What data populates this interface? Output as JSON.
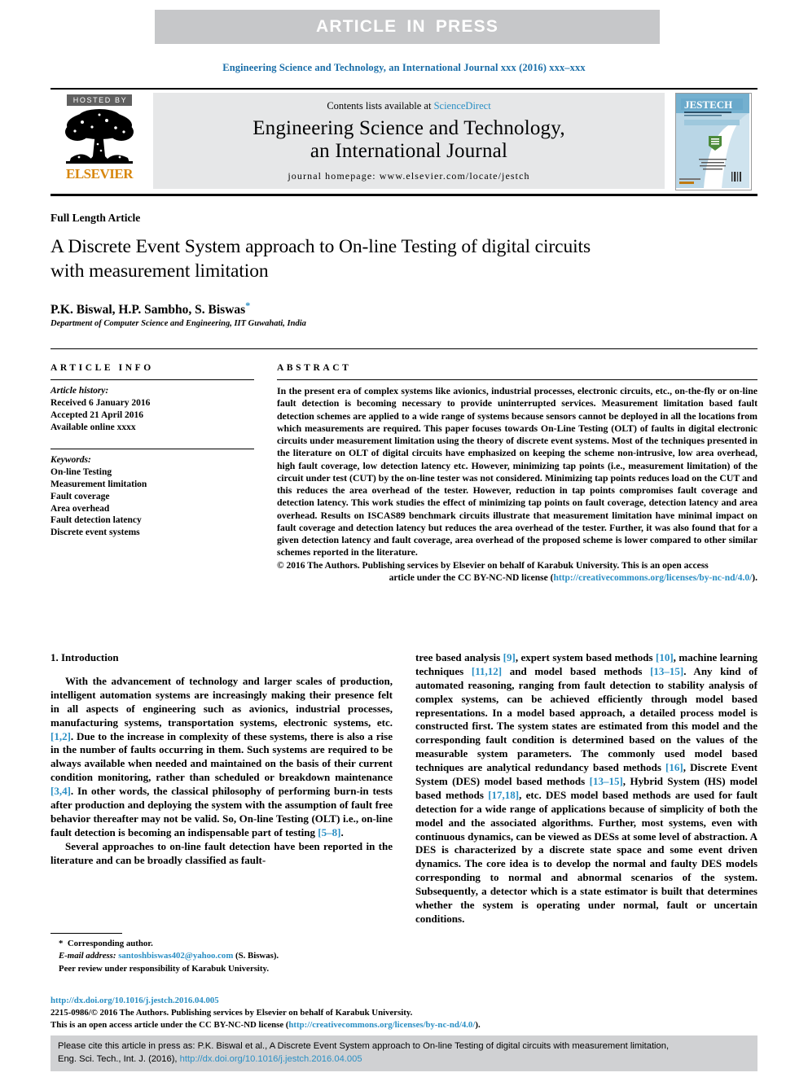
{
  "banner": {
    "text": "ARTICLE  IN  PRESS",
    "bg_color": "#c6c7c9",
    "text_color": "#ffffff"
  },
  "running_head": {
    "text": "Engineering Science and Technology, an International Journal xxx (2016) xxx–xxx",
    "color": "#1a6ea8"
  },
  "masthead": {
    "hosted_by_label": "HOSTED BY",
    "publisher_name": "ELSEVIER",
    "publisher_color": "#d8870d",
    "contents_prefix": "Contents lists available at ",
    "contents_link": "ScienceDirect",
    "journal_title_line1": "Engineering Science and Technology,",
    "journal_title_line2": "an International Journal",
    "homepage_text": "journal homepage: www.elsevier.com/locate/jestch",
    "cover_title": "JESTECH",
    "cover_subtitle": "ENGINEERING SCIENCE AND TECHNOLOGY",
    "cover_subtitle2": "an international journal",
    "link_color": "#2a8fc4"
  },
  "article": {
    "type": "Full Length Article",
    "title": "A Discrete Event System approach to On-line Testing of digital circuits with measurement limitation",
    "authors": "P.K. Biswal, H.P. Sambho, S. Biswas",
    "corresponding_marker": "*",
    "affiliation": "Department of Computer Science and Engineering, IIT Guwahati, India"
  },
  "article_info": {
    "heading": "ARTICLE INFO",
    "history_label": "Article history:",
    "history": [
      "Received 6 January 2016",
      "Accepted 21 April 2016",
      "Available online xxxx"
    ],
    "keywords_label": "Keywords:",
    "keywords": [
      "On-line Testing",
      "Measurement limitation",
      "Fault coverage",
      "Area overhead",
      "Fault detection latency",
      "Discrete event systems"
    ]
  },
  "abstract": {
    "heading": "ABSTRACT",
    "body": "In the present era of complex systems like avionics, industrial processes, electronic circuits, etc., on-the-fly or on-line fault detection is becoming necessary to provide uninterrupted services. Measurement limitation based fault detection schemes are applied to a wide range of systems because sensors cannot be deployed in all the locations from which measurements are required. This paper focuses towards On-Line Testing (OLT) of faults in digital electronic circuits under measurement limitation using the theory of discrete event systems. Most of the techniques presented in the literature on OLT of digital circuits have emphasized on keeping the scheme non-intrusive, low area overhead, high fault coverage, low detection latency etc. However, minimizing tap points (i.e., measurement limitation) of the circuit under test (CUT) by the on-line tester was not considered. Minimizing tap points reduces load on the CUT and this reduces the area overhead of the tester. However, reduction in tap points compromises fault coverage and detection latency. This work studies the effect of minimizing tap points on fault coverage, detection latency and area overhead. Results on ISCAS89 benchmark circuits illustrate that measurement limitation have minimal impact on fault coverage and detection latency but reduces the area overhead of the tester. Further, it was also found that for a given detection latency and fault coverage, area overhead of the proposed scheme is lower compared to other similar schemes reported in the literature.",
    "copyright_line1": "© 2016 The Authors. Publishing services by Elsevier on behalf of Karabuk University. This is an open access",
    "copyright_line2_prefix": "article under the CC BY-NC-ND license (",
    "copyright_license_url": "http://creativecommons.org/licenses/by-nc-nd/4.0/",
    "copyright_line2_suffix": ")."
  },
  "introduction": {
    "heading": "1. Introduction",
    "left_p1_a": "With the advancement of technology and larger scales of production, intelligent automation systems are increasingly making their presence felt in all aspects of engineering such as avionics, industrial processes, manufacturing systems, transportation systems, electronic systems, etc.",
    "left_ref1": "[1,2]",
    "left_p1_b": ". Due to the increase in complexity of these systems, there is also a rise in the number of faults occurring in them. Such systems are required to be always available when needed and maintained on the basis of their current condition monitoring, rather than scheduled or breakdown maintenance ",
    "left_ref2": "[3,4]",
    "left_p1_c": ". In other words, the classical philosophy of performing burn-in tests after production and deploying the system with the assumption of fault free behavior thereafter may not be valid. So, On-line Testing (OLT) i.e., on-line fault detection is becoming an indispensable part of testing ",
    "left_ref3": "[5–8]",
    "left_p1_d": ".",
    "left_p2": "Several approaches to on-line fault detection have been reported in the literature and can be broadly classified as fault-",
    "right_p1_a": "tree based analysis ",
    "right_ref1": "[9]",
    "right_p1_b": ", expert system based methods ",
    "right_ref2": "[10]",
    "right_p1_c": ", machine learning techniques ",
    "right_ref3": "[11,12]",
    "right_p1_d": " and model based methods ",
    "right_ref4": "[13–15]",
    "right_p1_e": ". Any kind of automated reasoning, ranging from fault detection to stability analysis of complex systems, can be achieved efficiently through model based representations. In a model based approach, a detailed process model is constructed first. The system states are estimated from this model and the corresponding fault condition is determined based on the values of the measurable system parameters. The commonly used model based techniques are analytical redundancy based methods ",
    "right_ref5": "[16]",
    "right_p1_f": ", Discrete Event System (DES) model based methods ",
    "right_ref6": "[13–15]",
    "right_p1_g": ", Hybrid System (HS) model based methods ",
    "right_ref7": "[17,18]",
    "right_p1_h": ", etc. DES model based methods are used for fault detection for a wide range of applications because of simplicity of both the model and the associated algorithms. Further, most systems, even with continuous dynamics, can be viewed as DESs at some level of abstraction. A DES is characterized by a discrete state space and some event driven dynamics. The core idea is to develop the normal and faulty DES models corresponding to normal and abnormal scenarios of the system. Subsequently, a detector which is a state estimator is built that determines whether the system is operating under normal, fault or uncertain conditions."
  },
  "footnotes": {
    "corresponding_marker": "*",
    "corresponding_text": "Corresponding author.",
    "email_label": "E-mail address:",
    "email": "santoshbiswas402@yahoo.com",
    "email_suffix": "(S. Biswas).",
    "peer_review": "Peer review under responsibility of Karabuk University."
  },
  "publication": {
    "doi_url": "http://dx.doi.org/10.1016/j.jestch.2016.04.005",
    "issn_line": "2215-0986/© 2016 The Authors. Publishing services by Elsevier on behalf of Karabuk University.",
    "license_prefix": "This is an open access article under the CC BY-NC-ND license (",
    "license_url": "http://creativecommons.org/licenses/by-nc-nd/4.0/",
    "license_suffix": ")."
  },
  "cite_box": {
    "line1": "Please cite this article in press as: P.K. Biswal et al., A Discrete Event System approach to On-line Testing of digital circuits with measurement limitation,",
    "line2_prefix": "Eng. Sci. Tech., Int. J. (2016), ",
    "line2_url": "http://dx.doi.org/10.1016/j.jestch.2016.04.005",
    "bg_color": "#d0d1d3"
  }
}
